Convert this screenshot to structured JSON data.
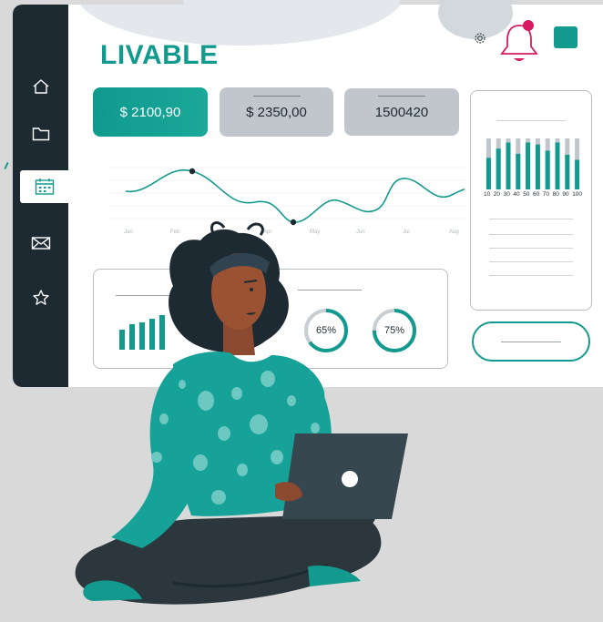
{
  "app": {
    "logo": "LIVABLE"
  },
  "colors": {
    "accent": "#139a8e",
    "sidebar": "#1e2a32",
    "alert": "#d81b60",
    "card_grey": "#c0c6cb"
  },
  "sidebar": {
    "items": [
      {
        "icon": "home-icon"
      },
      {
        "icon": "folder-icon"
      },
      {
        "icon": "calendar-icon",
        "active": true
      },
      {
        "icon": "mail-icon"
      },
      {
        "icon": "star-icon"
      }
    ]
  },
  "header": {
    "icons": [
      "gear-icon",
      "bell-icon",
      "menu-square-icon"
    ]
  },
  "stats": [
    {
      "value": "$ 2100,90",
      "highlight": true
    },
    {
      "value": "$ 2350,00"
    },
    {
      "value": "1500420"
    }
  ],
  "rings": [
    {
      "label": "65%",
      "percent": 65
    },
    {
      "label": "75%",
      "percent": 75
    }
  ],
  "chart_data": [
    {
      "type": "line",
      "x": [
        "Jan",
        "Feb",
        "Mar",
        "Apr",
        "May",
        "Jun",
        "Jul",
        "Aug"
      ],
      "xlabel": "",
      "ylabel": ""
    },
    {
      "type": "bar",
      "categories": [
        "10",
        "20",
        "30",
        "40",
        "50",
        "60",
        "70",
        "80",
        "90",
        "100"
      ],
      "series": [
        {
          "values": [
            0.62,
            0.8,
            0.92,
            0.7,
            0.92,
            0.88,
            0.76,
            0.92,
            0.68,
            0.58
          ]
        },
        {
          "values": [
            1,
            1,
            1,
            1,
            1,
            1,
            1,
            1,
            1,
            1
          ]
        }
      ]
    }
  ]
}
